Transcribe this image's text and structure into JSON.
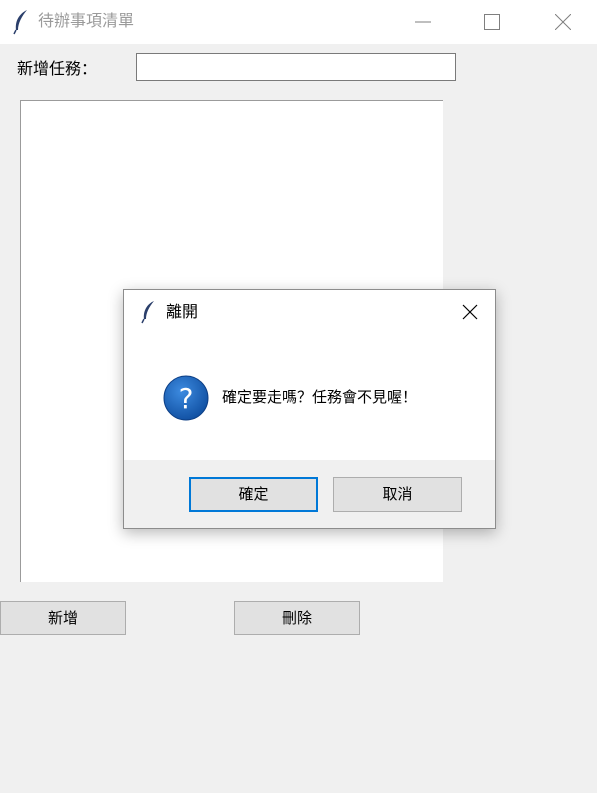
{
  "window": {
    "title": "待辦事項清單",
    "icon": "feather-icon"
  },
  "form": {
    "task_label": "新增任務：",
    "task_value": "",
    "task_placeholder": ""
  },
  "buttons": {
    "add_label": "新增",
    "delete_label": "刪除"
  },
  "dialog": {
    "title": "離開",
    "icon": "question-icon",
    "message": "確定要走嗎？任務會不見喔！",
    "ok_label": "確定",
    "cancel_label": "取消"
  },
  "colors": {
    "accent": "#0078d7",
    "background": "#f0f0f0",
    "question_icon": "#1a64b8"
  }
}
